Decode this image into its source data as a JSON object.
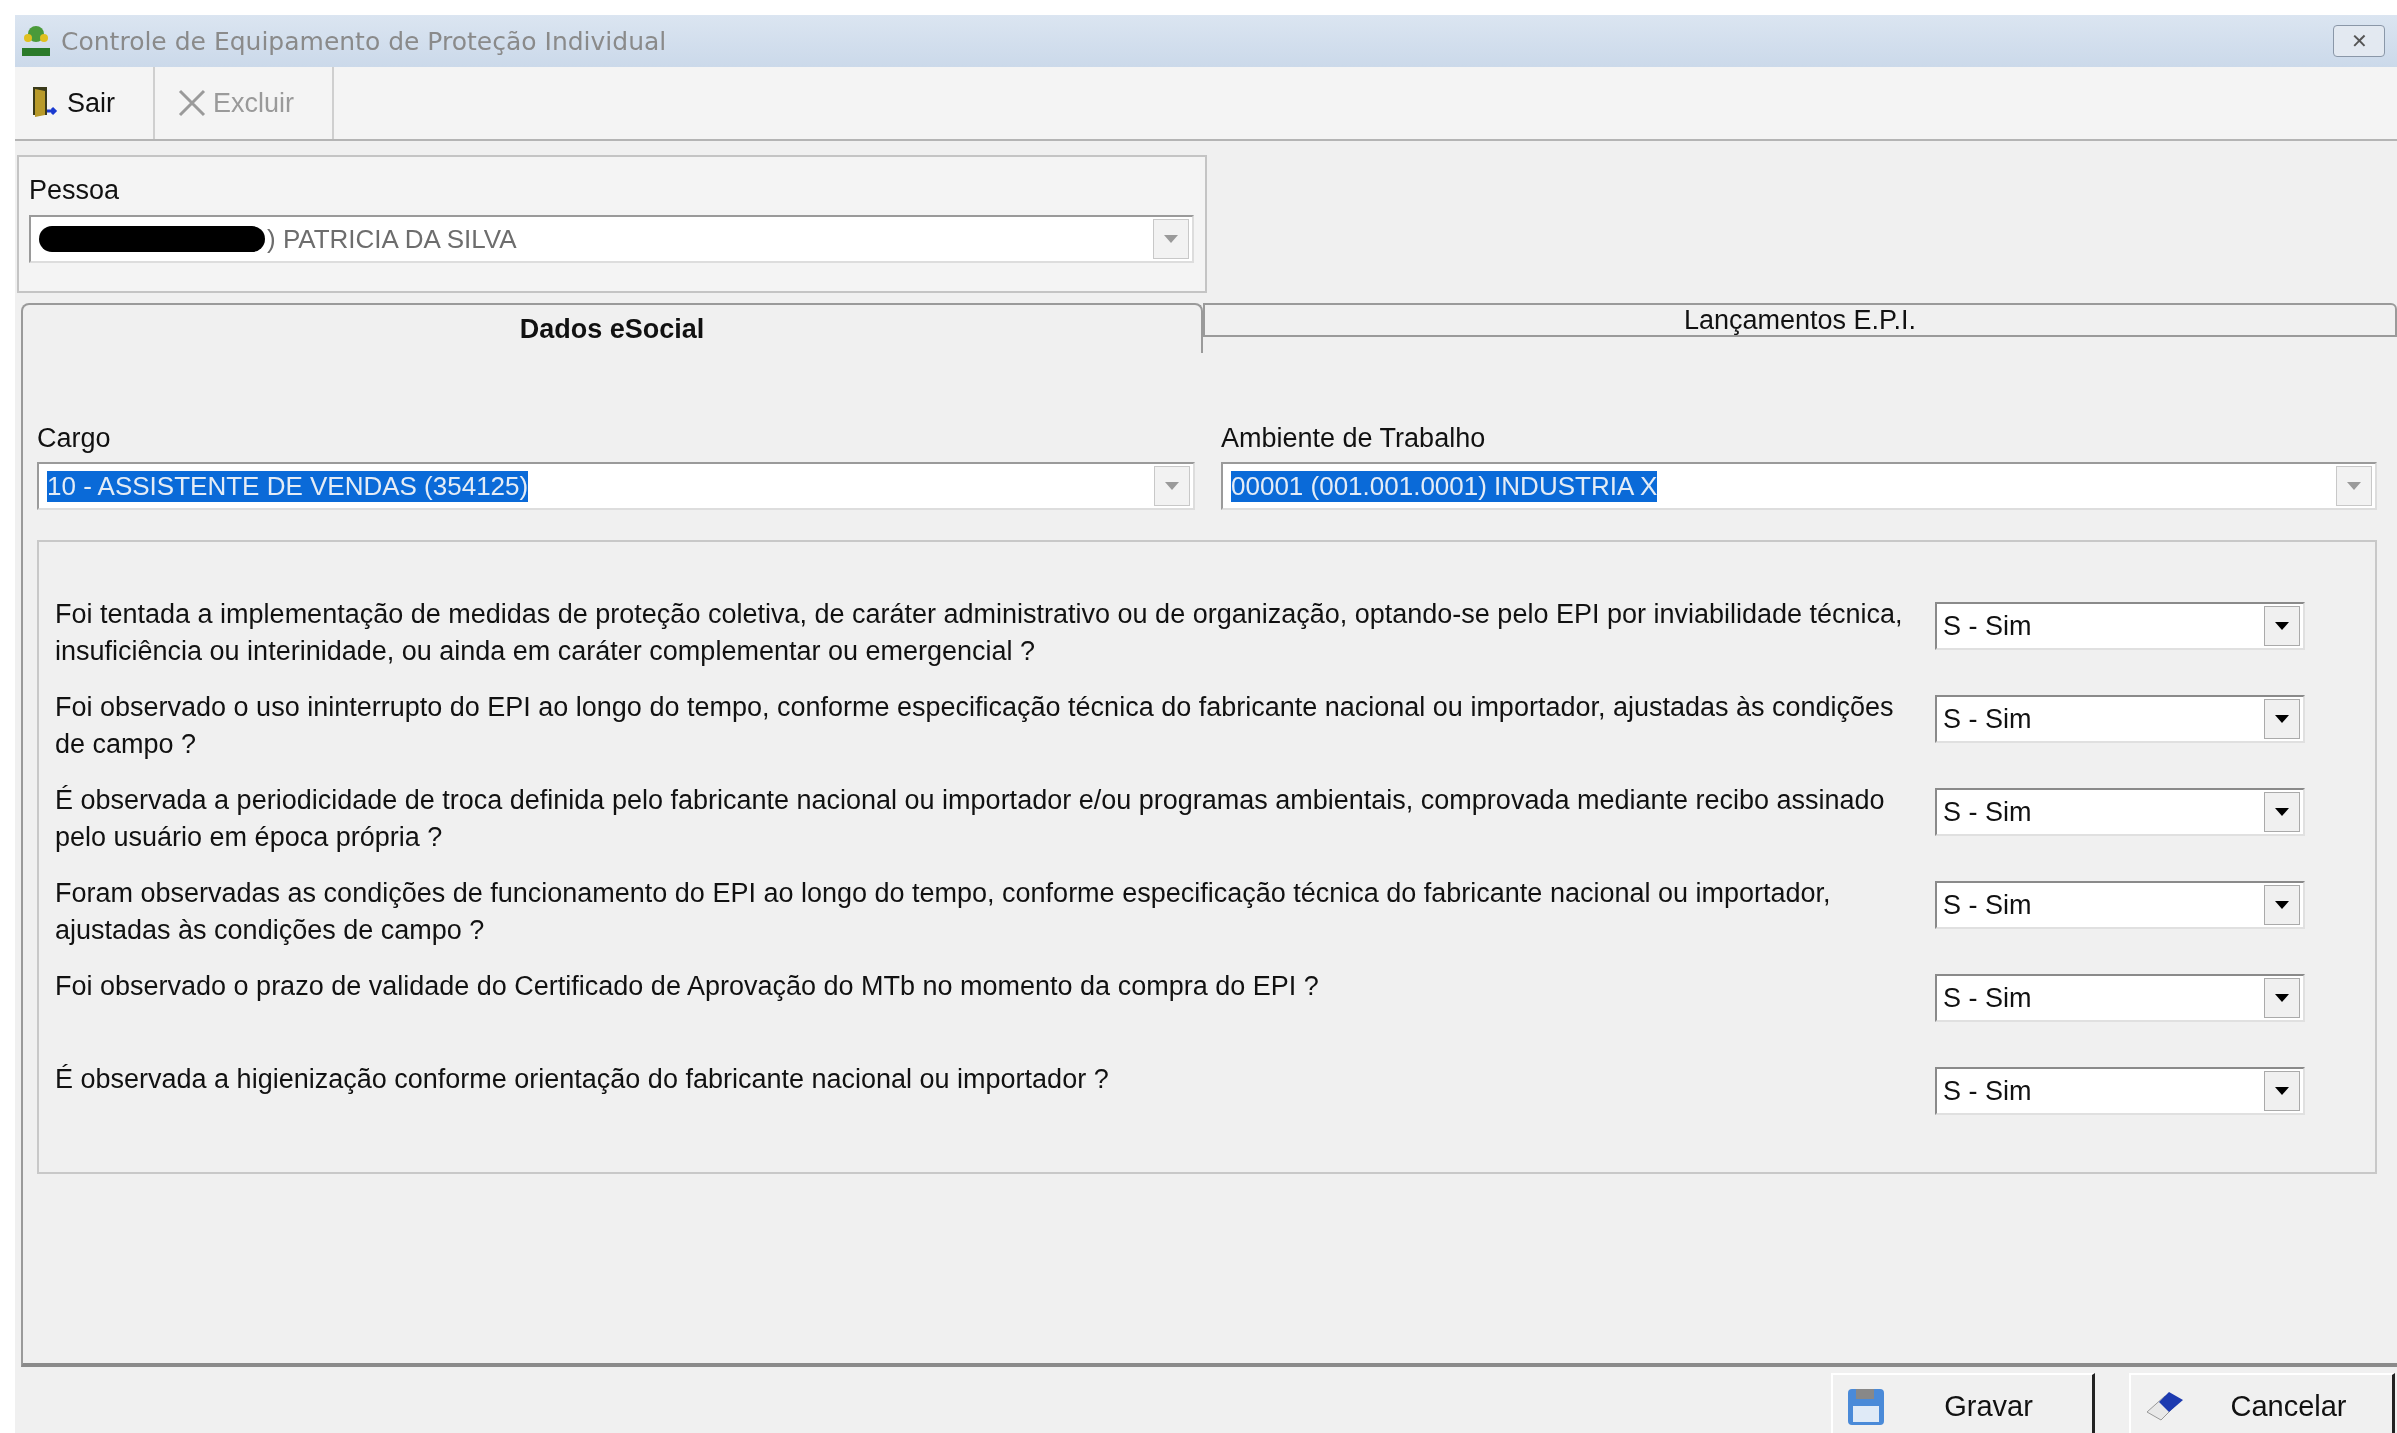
{
  "window": {
    "title": "Controle de Equipamento de Proteção Individual",
    "close": "✕"
  },
  "toolbar": [
    {
      "label": "Sair",
      "kind": "exit",
      "disabled": false
    },
    {
      "label": "Excluir",
      "kind": "delete",
      "disabled": true
    }
  ],
  "pessoa": {
    "label": "Pessoa",
    "value": ") PATRICIA DA SILVA",
    "redacted": true
  },
  "tabs": [
    {
      "label": "Dados eSocial",
      "selected": true
    },
    {
      "label": "Lançamentos E.P.I.",
      "selected": false
    }
  ],
  "cargo": {
    "label": "Cargo",
    "value": "10 - ASSISTENTE DE VENDAS (354125)",
    "highlighted": true
  },
  "ambiente": {
    "label": "Ambiente de Trabalho",
    "value": "00001 (001.001.0001) INDUSTRIA X",
    "highlighted": true
  },
  "questions": [
    {
      "text": "Foi tentada a implementação de medidas de proteção coletiva, de caráter administrativo ou de organização, optando-se pelo EPI por inviabilidade técnica, insuficiência ou interinidade, ou ainda em caráter complementar ou emergencial ?",
      "answer": "S - Sim"
    },
    {
      "text": "Foi observado o uso ininterrupto do EPI ao longo do tempo, conforme especificação técnica do fabricante nacional ou importador, ajustadas às condições de campo ?",
      "answer": "S - Sim"
    },
    {
      "text": "É observada a periodicidade de troca definida pelo fabricante nacional ou importador e/ou programas ambientais, comprovada mediante recibo assinado pelo usuário em época própria ?",
      "answer": "S - Sim"
    },
    {
      "text": "Foram observadas as condições de funcionamento do EPI ao longo do tempo, conforme especificação técnica do fabricante nacional ou importador, ajustadas às condições de campo ?",
      "answer": "S - Sim"
    },
    {
      "text": "Foi observado o prazo de validade do Certificado de Aprovação do MTb no momento da compra do EPI ?",
      "answer": "S - Sim"
    },
    {
      "text": "É observada a higienização conforme orientação do fabricante nacional ou importador ?",
      "answer": "S - Sim"
    }
  ],
  "buttons": [
    {
      "label": "Gravar",
      "kind": "save"
    },
    {
      "label": "Cancelar",
      "kind": "cancel"
    }
  ]
}
